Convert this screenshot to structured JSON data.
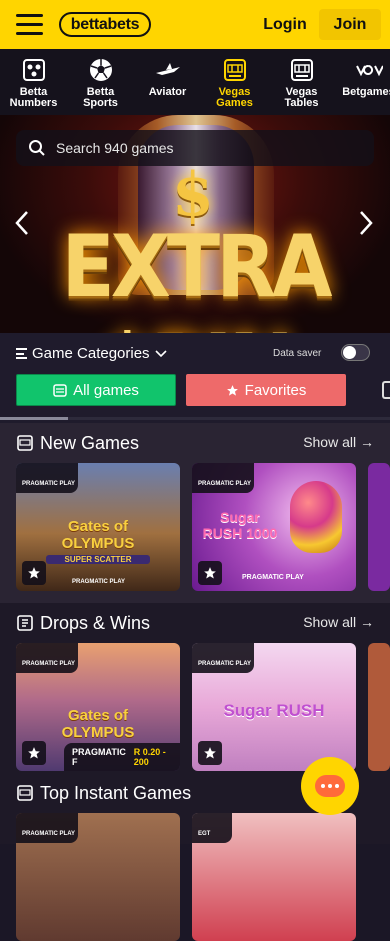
{
  "header": {
    "logo_text": "bettabets",
    "login_label": "Login",
    "join_label": "Join"
  },
  "nav": {
    "items": [
      {
        "label": "Betta\nNumbers",
        "icon": "lottery-balls-icon"
      },
      {
        "label": "Betta\nSports",
        "icon": "soccer-ball-icon"
      },
      {
        "label": "Aviator",
        "icon": "airplane-icon"
      },
      {
        "label": "Vegas\nGames",
        "icon": "slot-machine-icon",
        "active": true
      },
      {
        "label": "Vegas\nTables",
        "icon": "slot-machine-icon"
      },
      {
        "label": "Betgames",
        "icon": "betgames-logo-icon"
      }
    ]
  },
  "banner": {
    "search_placeholder": "Search 940 games",
    "title": "EXTRA $PIN"
  },
  "categories": {
    "title": "Game Categories",
    "data_saver_label": "Data saver",
    "all_games_label": "All games",
    "favorites_label": "Favorites"
  },
  "sections": [
    {
      "title": "New Games",
      "show_all": "Show all",
      "cards": [
        {
          "game_title": "Gates of OLYMPUS",
          "subtitle": "SUPER SCATTER",
          "provider_badge": "PRAGMATIC PLAY",
          "provider_footer": "PRAGMATIC PLAY"
        },
        {
          "game_title": "Sugar RUSH 1000",
          "provider_badge": "PRAGMATIC PLAY",
          "provider_footer": "PRAGMATIC PLAY"
        }
      ]
    },
    {
      "title": "Drops & Wins",
      "show_all": "Show all",
      "cards": [
        {
          "game_title": "Gates of OLYMPUS",
          "provider_badge": "PRAGMATIC PLAY",
          "footer_provider": "PRAGMATIC F",
          "footer_range": "R 0.20 - 200"
        },
        {
          "game_title": "Sugar RUSH",
          "provider_badge": "PRAGMATIC PLAY"
        }
      ]
    },
    {
      "title": "Top Instant Games",
      "cards": [
        {
          "provider_badge": "PRAGMATIC PLAY"
        },
        {
          "provider_badge": "EGT"
        }
      ]
    }
  ],
  "colors": {
    "brand_yellow": "#ffd500",
    "green": "#11c46c",
    "coral": "#ee6a6a",
    "bg": "#1b1726"
  }
}
